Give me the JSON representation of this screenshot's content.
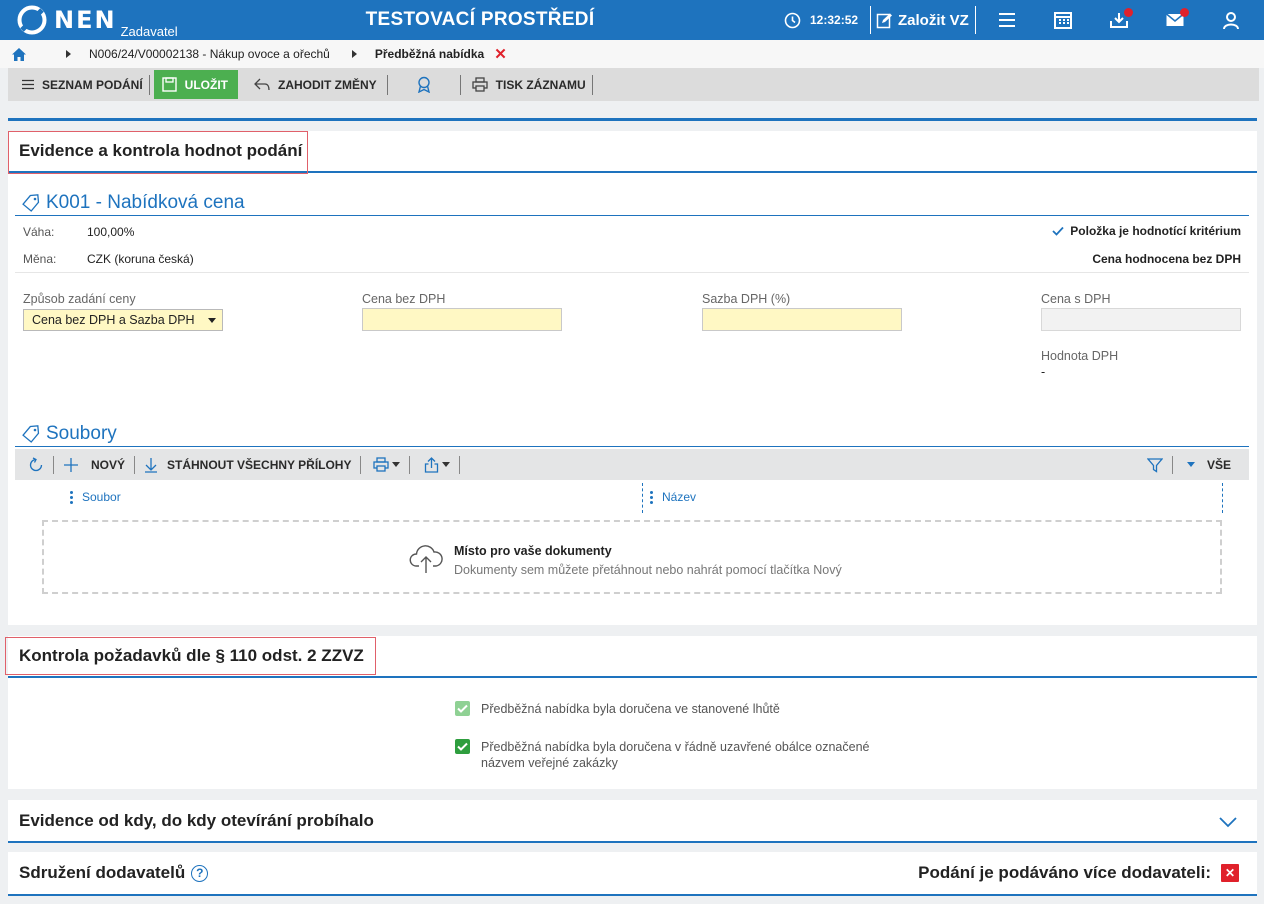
{
  "app": {
    "logo_text": "NEN",
    "logo_sub": "Zadavatel",
    "env_title": "TESTOVACÍ PROSTŘEDÍ",
    "clock": "12:32:52",
    "create_label": "Založit VZ"
  },
  "breadcrumb": {
    "items": [
      "N006/24/V00002138 - Nákup ovoce a ořechů",
      "Předběžná nabídka"
    ],
    "close": "✕"
  },
  "toolbar": {
    "list_label": "SEZNAM PODÁNÍ",
    "save_label": "ULOŽIT",
    "discard_label": "ZAHODIT ZMĚNY",
    "print_label": "TISK ZÁZNAMU"
  },
  "evidence": {
    "title": "Evidence a kontrola hodnot podání",
    "criterion_title": "K001 - Nabídková cena",
    "weight_label": "Váha:",
    "weight_value": "100,00%",
    "currency_label": "Měna:",
    "currency_value": "CZK (koruna česká)",
    "criterion_flag": "Položka je hodnotící kritérium",
    "price_eval": "Cena hodnocena bez DPH",
    "price_mode_label": "Způsob zadání ceny",
    "price_mode_value": "Cena bez DPH a Sazba DPH",
    "price_wo_vat_label": "Cena bez DPH",
    "vat_rate_label": "Sazba DPH (%)",
    "price_w_vat_label": "Cena s DPH",
    "vat_value_label": "Hodnota DPH",
    "vat_value": "-"
  },
  "files": {
    "title": "Soubory",
    "new_label": "NOVÝ",
    "download_all_label": "STÁHNOUT VŠECHNY PŘÍLOHY",
    "all_label": "VŠE",
    "col_file": "Soubor",
    "col_name": "Název",
    "dropzone_title": "Místo pro vaše dokumenty",
    "dropzone_sub": "Dokumenty sem můžete přetáhnout nebo nahrát pomocí tlačítka Nový"
  },
  "control": {
    "title": "Kontrola požadavků dle § 110 odst. 2 ZZVZ",
    "check1": "Předběžná nabídka byla doručena ve stanovené lhůtě",
    "check2": "Předběžná nabídka byla doručena v řádně uzavřené obálce označené názvem veřejné zakázky"
  },
  "opening": {
    "title": "Evidence od kdy, do kdy otevírání probíhalo"
  },
  "association": {
    "title": "Sdružení dodavatelů",
    "help": "?",
    "multi_label": "Podání je podáváno více dodavateli:",
    "multi_value": "✕"
  },
  "colors": {
    "brand": "#1e73be",
    "save": "#4caf50",
    "danger": "#e0212b"
  }
}
